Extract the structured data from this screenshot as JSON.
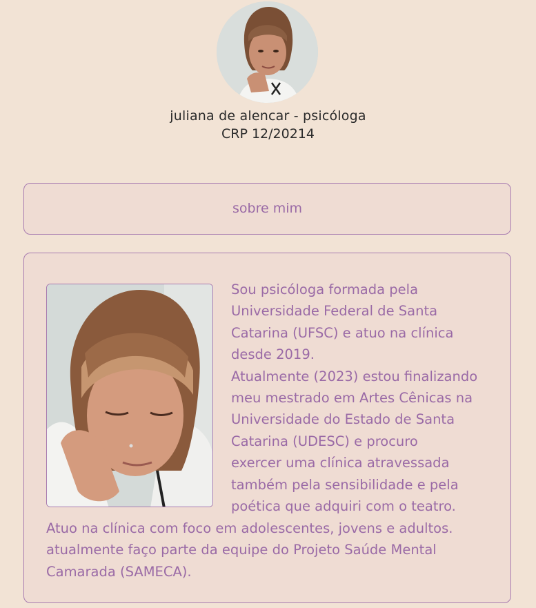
{
  "profile": {
    "name": "juliana de alencar - psicóloga",
    "registration": "CRP 12/20214",
    "avatar_icon": "profile-photo"
  },
  "about_button": {
    "label": "sobre mim"
  },
  "about_card": {
    "photo_icon": "portrait-photo",
    "side_lines": [
      "Sou psicóloga formada pela",
      "Universidade Federal de Santa",
      "Catarina (UFSC) e atuo na clínica",
      "desde 2019.",
      "Atualmente (2023) estou finalizando",
      "meu mestrado em Artes Cênicas na",
      "Universidade do Estado de Santa",
      "Catarina (UDESC) e procuro",
      "exercer uma clínica atravessada",
      "também pela sensibilidade e pela",
      "poética que adquiri com o teatro."
    ],
    "full_lines": [
      "Atuo na clínica com foco em adolescentes, jovens e adultos.",
      "atualmente faço parte da equipe do Projeto Saúde Mental",
      "Camarada (SAMECA)."
    ]
  },
  "colors": {
    "background": "#f2e3d5",
    "accent": "#9a6aa6",
    "border": "#a77bb0",
    "card": "#efdcd3"
  }
}
